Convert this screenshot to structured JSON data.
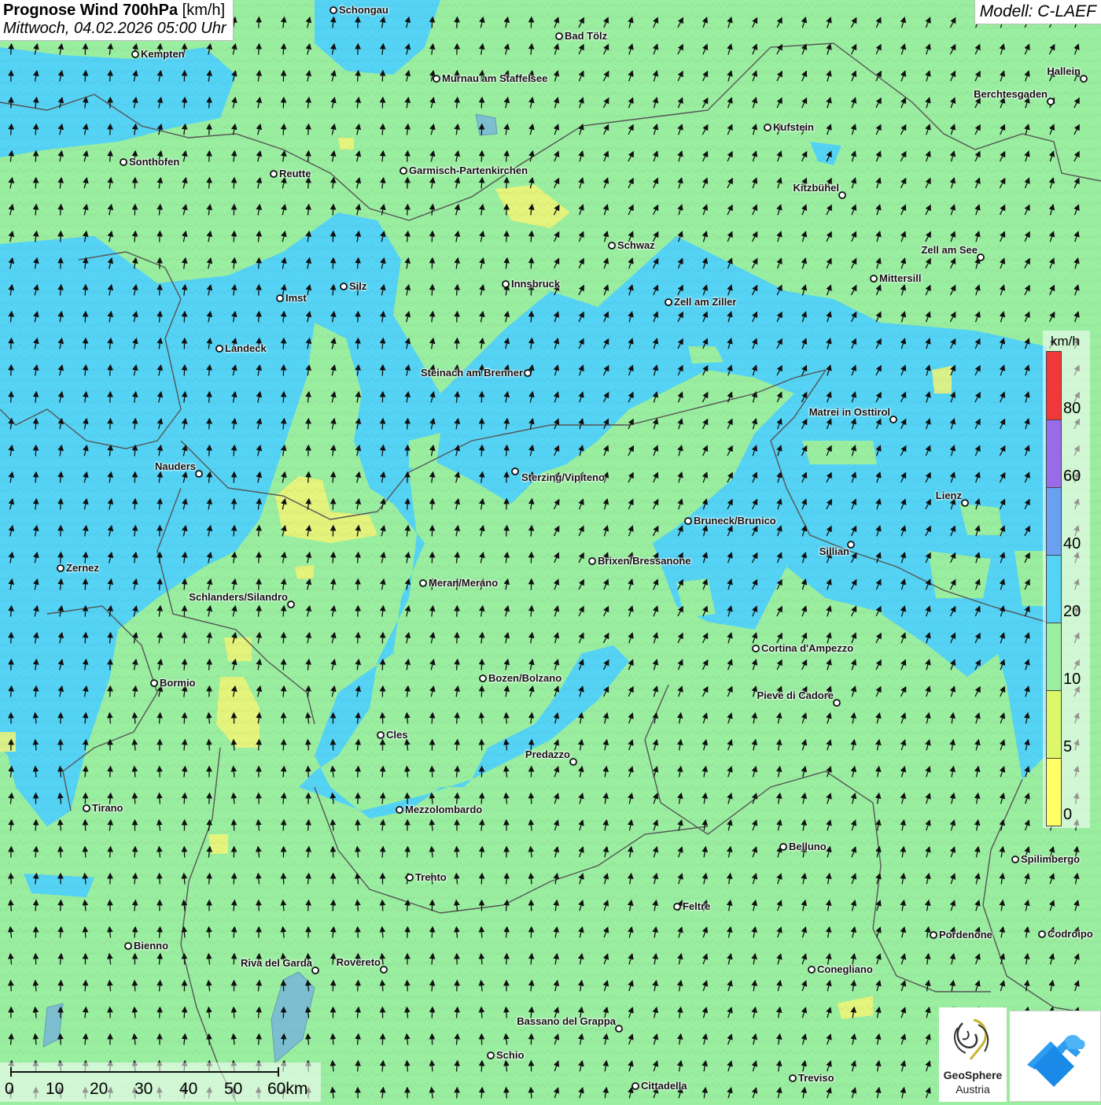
{
  "title": {
    "main": "Prognose Wind 700hPa",
    "unit": "[km/h]",
    "datetime": "Mittwoch, 04.02.2026 05:00 Uhr"
  },
  "model": "Modell: C-LAEF",
  "cities": [
    {
      "name": "Schongau"
    },
    {
      "name": "Bad Tölz"
    },
    {
      "name": "Kempten"
    },
    {
      "name": "Murnau am Staffelsee"
    },
    {
      "name": "Hallein"
    },
    {
      "name": "Berchtesgaden"
    },
    {
      "name": "Kufstein"
    },
    {
      "name": "Sonthofen"
    },
    {
      "name": "Reutte"
    },
    {
      "name": "Garmisch-Partenkirchen"
    },
    {
      "name": "Kitzbühel"
    },
    {
      "name": "Schwaz"
    },
    {
      "name": "Zell am See"
    },
    {
      "name": "Mittersill"
    },
    {
      "name": "Imst"
    },
    {
      "name": "Silz"
    },
    {
      "name": "Innsbruck"
    },
    {
      "name": "Zell am Ziller"
    },
    {
      "name": "Landeck"
    },
    {
      "name": "Steinach am Brenner"
    },
    {
      "name": "Matrei in Osttirol"
    },
    {
      "name": "Nauders"
    },
    {
      "name": "Sterzing/Vipiteno"
    },
    {
      "name": "Lienz"
    },
    {
      "name": "Bruneck/Brunico"
    },
    {
      "name": "Sillian"
    },
    {
      "name": "Zernez"
    },
    {
      "name": "Brixen/Bressanone"
    },
    {
      "name": "Meran/Merano"
    },
    {
      "name": "Schlanders/Silandro"
    },
    {
      "name": "Cortina d'Ampezzo"
    },
    {
      "name": "Bozen/Bolzano"
    },
    {
      "name": "Bormio"
    },
    {
      "name": "Pieve di Cadore"
    },
    {
      "name": "Cles"
    },
    {
      "name": "Predazzo"
    },
    {
      "name": "Tirano"
    },
    {
      "name": "Mezzolombardo"
    },
    {
      "name": "Belluno"
    },
    {
      "name": "Spilimbergo"
    },
    {
      "name": "Trento"
    },
    {
      "name": "Feltre"
    },
    {
      "name": "Pordenone"
    },
    {
      "name": "Codroipo"
    },
    {
      "name": "Bienno"
    },
    {
      "name": "Riva del Garda"
    },
    {
      "name": "Rovereto"
    },
    {
      "name": "Conegliano"
    },
    {
      "name": "Bassano del Grappa"
    },
    {
      "name": "Schio"
    },
    {
      "name": "Treviso"
    },
    {
      "name": "Cittadella"
    }
  ],
  "legend": {
    "unit": "km/h",
    "classes": [
      {
        "label": "0",
        "color": "#ffff66"
      },
      {
        "label": "5",
        "color": "#ddf76a"
      },
      {
        "label": "10",
        "color": "#9aeea0"
      },
      {
        "label": "20",
        "color": "#55d3f5"
      },
      {
        "label": "40",
        "color": "#6aa0f0"
      },
      {
        "label": "60",
        "color": "#9a6be8"
      },
      {
        "label": "80",
        "color": "#f03838"
      }
    ]
  },
  "scale": {
    "ticks": [
      "0",
      "10",
      "20",
      "30",
      "40",
      "50",
      "60km"
    ]
  },
  "logo": {
    "line1": "GeoSphere",
    "line2": "Austria"
  },
  "colors": {
    "calm_yellow": "#f2f476",
    "light_green": "#9aeea0",
    "cyan": "#55d3f5",
    "border_grey": "#555555"
  }
}
